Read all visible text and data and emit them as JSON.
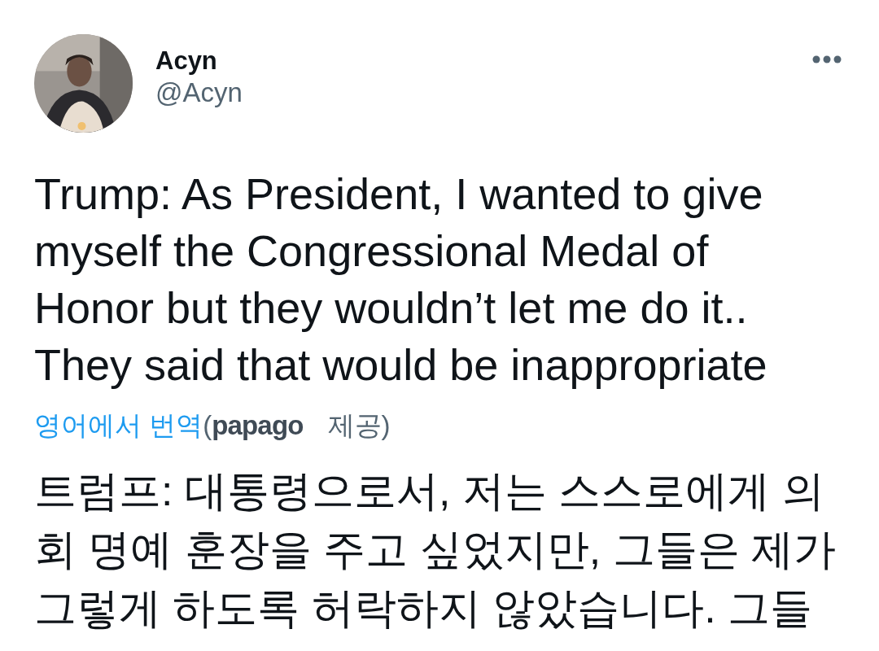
{
  "tweet": {
    "author": {
      "name": "Acyn",
      "handle": "@Acyn"
    },
    "text_lines": [
      "Trump: As President, I wanted to give",
      "myself the Congressional Medal of",
      "Honor but they wouldn’t let me do it..",
      "They said that would be inappropriate"
    ],
    "translation": {
      "label": "영어에서 번역",
      "open": "(",
      "provider": "papago",
      "close": "제공)"
    },
    "translated_lines": [
      "트럼프: 대통령으로서, 저는 스스로에게 의",
      "회 명예 훈장을 주고 싶었지만, 그들은 제가",
      "그렇게 하도록 허락하지 않았습니다. 그들"
    ]
  }
}
